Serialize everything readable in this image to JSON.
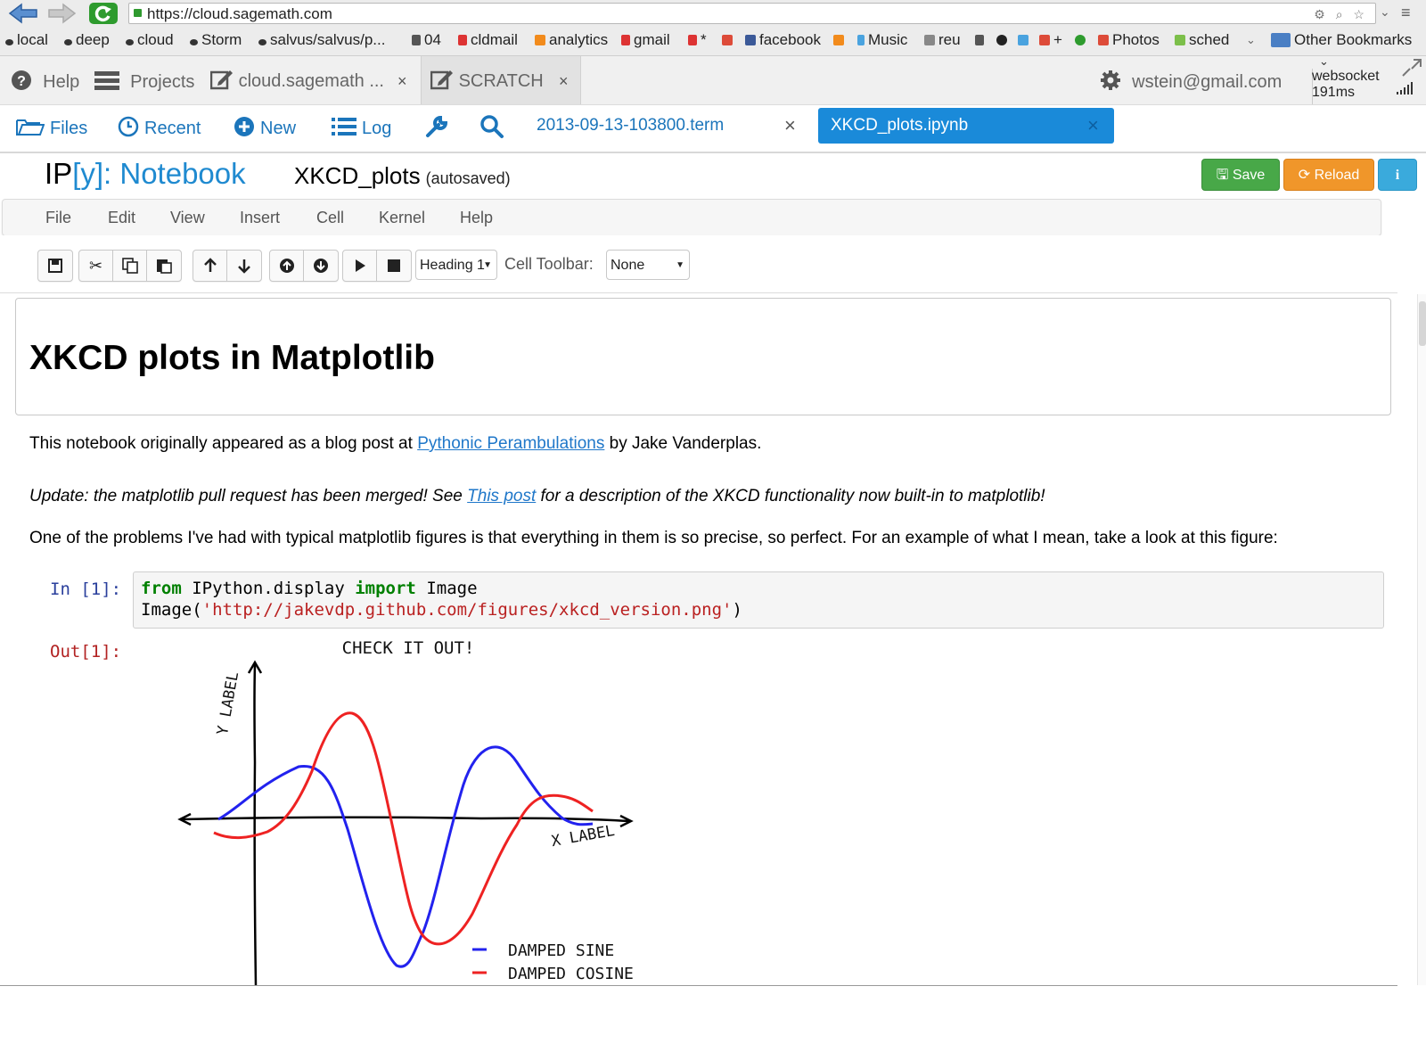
{
  "browser": {
    "url": "https://cloud.sagemath.com",
    "bookmarks": [
      "local",
      "deep",
      "cloud",
      "Storm",
      "salvus/salvus/p...",
      "04",
      "cldmail",
      "analytics",
      "gmail",
      "*",
      "facebook",
      "Music",
      "reu",
      "+",
      "Photos",
      "sched"
    ],
    "other_bookmarks": "Other Bookmarks"
  },
  "sage": {
    "help": "Help",
    "projects": "Projects",
    "project_tab": "cloud.sagemath ...",
    "scratch_tab": "SCRATCH",
    "user": "wstein@gmail.com",
    "websocket_label": "websocket",
    "websocket_ping": "191ms"
  },
  "project_nav": {
    "files": "Files",
    "recent": "Recent",
    "new": "New",
    "log": "Log",
    "file_tabs": [
      "2013-09-13-103800.term",
      "XKCD_plots.ipynb"
    ]
  },
  "notebook": {
    "logo_prefix": "IP",
    "logo_y": "[y]",
    "logo_colon_notebook": ": Notebook",
    "title": "XKCD_plots",
    "autosave": "(autosaved)",
    "buttons": {
      "save": "Save",
      "reload": "Reload"
    },
    "menu": [
      "File",
      "Edit",
      "View",
      "Insert",
      "Cell",
      "Kernel",
      "Help"
    ],
    "cell_type": "Heading 1",
    "cell_toolbar_label": "Cell Toolbar:",
    "cell_toolbar_value": "None"
  },
  "content": {
    "heading": "XKCD plots in Matplotlib",
    "p1_before": "This notebook originally appeared as a blog post at ",
    "p1_link": "Pythonic Perambulations",
    "p1_after": " by Jake Vanderplas.",
    "p2_before": "Update: the matplotlib pull request has been merged! See ",
    "p2_link": "This post",
    "p2_after": " for a description of the XKCD functionality now built-in to matplotlib!",
    "p3": "One of the problems I've had with typical matplotlib figures is that everything in them is so precise, so perfect. For an example of what I mean, take a look at this figure:",
    "in_prompt": "In [1]:",
    "out_prompt": "Out[1]:",
    "code_line1": {
      "kw1": "from",
      "mod": " IPython.display ",
      "kw2": "import",
      "name": " Image"
    },
    "code_line2": {
      "call": "Image(",
      "arg": "'http://jakevdp.github.com/figures/xkcd_version.png'",
      "close": ")"
    }
  },
  "figure": {
    "title": "CHECK IT OUT!",
    "ylabel": "Y LABEL",
    "xlabel": "X LABEL",
    "legend": [
      "DAMPED SINE",
      "DAMPED COSINE"
    ],
    "colors": {
      "sine": "#2222ee",
      "cosine": "#ee2222"
    }
  }
}
